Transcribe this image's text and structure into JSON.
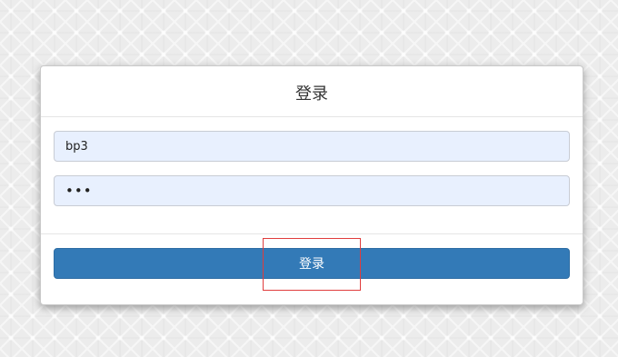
{
  "login": {
    "title": "登录",
    "username_value": "bp3",
    "password_value": "•••",
    "submit_label": "登录"
  },
  "colors": {
    "button_primary": "#337ab7",
    "input_autofill_bg": "#e8f0fe",
    "highlight_box": "#e03c3c"
  }
}
